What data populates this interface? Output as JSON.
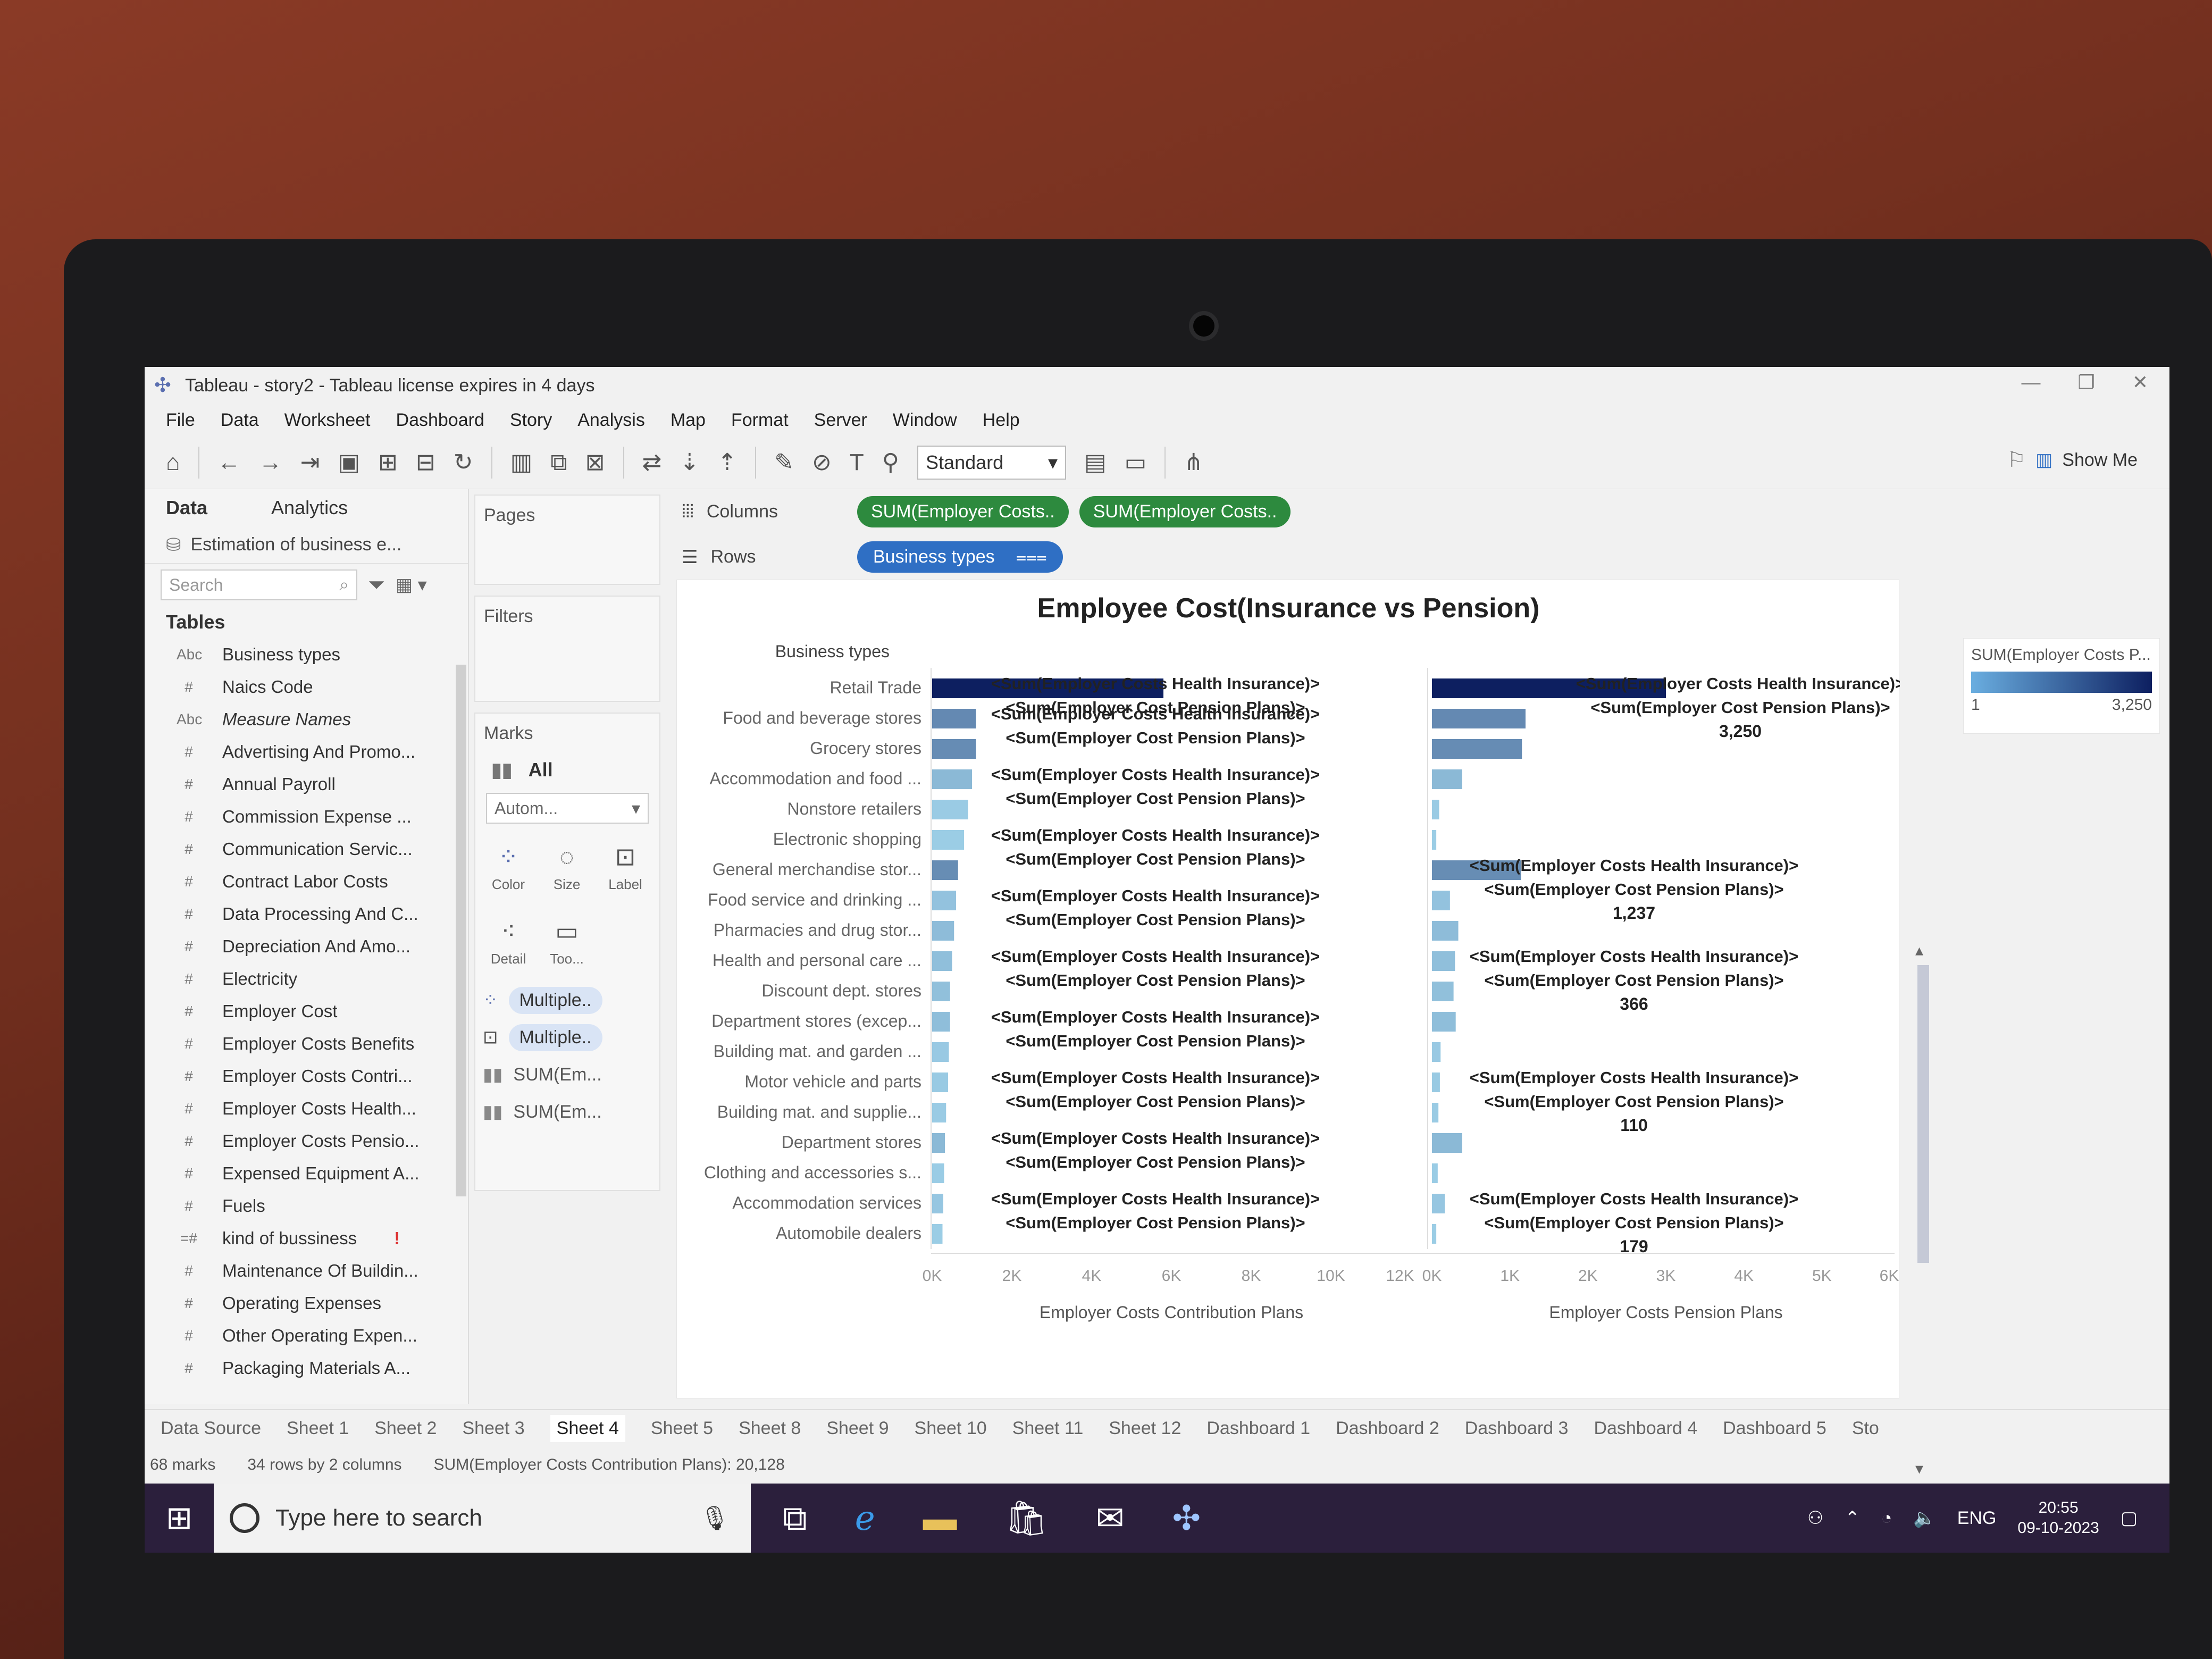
{
  "window": {
    "title": "Tableau - story2 - Tableau license expires in 4 days"
  },
  "menu": [
    "File",
    "Data",
    "Worksheet",
    "Dashboard",
    "Story",
    "Analysis",
    "Map",
    "Format",
    "Server",
    "Window",
    "Help"
  ],
  "toolbar": {
    "fit": "Standard",
    "show_me": "Show Me"
  },
  "left": {
    "tab_data": "Data",
    "tab_analytics": "Analytics",
    "datasource": "Estimation of business e...",
    "search_placeholder": "Search",
    "tables_header": "Tables",
    "fields": [
      {
        "type": "Abc",
        "name": "Business types"
      },
      {
        "type": "#",
        "name": "Naics Code"
      },
      {
        "type": "Abc",
        "name": "Measure Names",
        "italic": true
      },
      {
        "type": "#",
        "name": "Advertising And Promo..."
      },
      {
        "type": "#",
        "name": "Annual Payroll"
      },
      {
        "type": "#",
        "name": "Commission Expense ..."
      },
      {
        "type": "#",
        "name": "Communication Servic..."
      },
      {
        "type": "#",
        "name": "Contract Labor Costs"
      },
      {
        "type": "#",
        "name": "Data Processing And C..."
      },
      {
        "type": "#",
        "name": "Depreciation And Amo..."
      },
      {
        "type": "#",
        "name": "Electricity"
      },
      {
        "type": "#",
        "name": "Employer Cost"
      },
      {
        "type": "#",
        "name": "Employer Costs Benefits"
      },
      {
        "type": "#",
        "name": "Employer Costs Contri..."
      },
      {
        "type": "#",
        "name": "Employer Costs Health..."
      },
      {
        "type": "#",
        "name": "Employer Costs Pensio..."
      },
      {
        "type": "#",
        "name": "Expensed Equipment A..."
      },
      {
        "type": "#",
        "name": "Fuels"
      },
      {
        "type": "=#",
        "name": "kind of bussiness",
        "warn": "!"
      },
      {
        "type": "#",
        "name": "Maintenance Of Buildin..."
      },
      {
        "type": "#",
        "name": "Operating Expenses"
      },
      {
        "type": "#",
        "name": "Other Operating Expen..."
      },
      {
        "type": "#",
        "name": "Packaging Materials A..."
      }
    ]
  },
  "cards": {
    "pages": "Pages",
    "filters": "Filters",
    "marks": "Marks",
    "all": "All",
    "mark_type": "Autom...",
    "color": "Color",
    "size": "Size",
    "label": "Label",
    "detail": "Detail",
    "tooltip": "Too...",
    "pill1": "Multiple..",
    "pill2": "Multiple..",
    "pill3": "SUM(Em...",
    "pill4": "SUM(Em..."
  },
  "shelves": {
    "columns_label": "Columns",
    "rows_label": "Rows",
    "col_pill1": "SUM(Employer Costs..",
    "col_pill2": "SUM(Employer Costs..",
    "row_pill": "Business types"
  },
  "legend": {
    "title": "SUM(Employer Costs P...",
    "min": "1",
    "max": "3,250",
    "color_min": "#6aaee0",
    "color_max": "#0d1f60"
  },
  "chart_data": {
    "type": "bar",
    "title": "Employee Cost(Insurance vs Pension)",
    "row_header": "Business types",
    "categories": [
      "Retail Trade",
      "Food and beverage stores",
      "Grocery stores",
      "Accommodation and food ...",
      "Nonstore retailers",
      "Electronic shopping",
      "General merchandise stor...",
      "Food service and drinking ...",
      "Pharmacies and drug stor...",
      "Health and personal care ...",
      "Discount dept. stores",
      "Department stores (excep...",
      "Building mat. and garden ...",
      "Motor vehicle and parts",
      "Building mat. and supplie...",
      "Department stores",
      "Clothing and accessories s...",
      "Accommodation services",
      "Automobile dealers"
    ],
    "panes": [
      {
        "xlabel": "Employer Costs Contribution Plans",
        "xlim": [
          0,
          12000
        ],
        "ticks": [
          "0K",
          "2K",
          "4K",
          "6K",
          "8K",
          "10K",
          "12K"
        ],
        "values": [
          5800,
          1100,
          1100,
          1000,
          900,
          800,
          650,
          600,
          550,
          500,
          450,
          450,
          420,
          400,
          350,
          320,
          300,
          280,
          260
        ]
      },
      {
        "xlabel": "Employer Costs Pension Plans",
        "xlim": [
          0,
          6500
        ],
        "ticks": [
          "0K",
          "1K",
          "2K",
          "3K",
          "4K",
          "5K",
          "6K"
        ],
        "values": [
          3250,
          1300,
          1250,
          420,
          100,
          60,
          1237,
          250,
          366,
          320,
          300,
          330,
          120,
          110,
          90,
          420,
          80,
          179,
          60
        ]
      }
    ],
    "label_line1": "<Sum(Employer Costs Health Insurance)>",
    "label_line2": "<Sum(Employer Cost Pension Plans)>",
    "pane1_label_rows": [
      0,
      1,
      3,
      5,
      7,
      9,
      11,
      13,
      15,
      17,
      19
    ],
    "pane2_labels": [
      {
        "row": 0,
        "value": "3,250"
      },
      {
        "row": 6,
        "value": "1,237"
      },
      {
        "row": 9,
        "value": "366"
      },
      {
        "row": 13,
        "value": "110"
      },
      {
        "row": 17,
        "value": "179"
      }
    ]
  },
  "sheets": [
    "Data Source",
    "Sheet 1",
    "Sheet 2",
    "Sheet 3",
    "Sheet 4",
    "Sheet 5",
    "Sheet 8",
    "Sheet 9",
    "Sheet 10",
    "Sheet 11",
    "Sheet 12",
    "Dashboard 1",
    "Dashboard 2",
    "Dashboard 3",
    "Dashboard 4",
    "Dashboard 5",
    "Sto"
  ],
  "active_sheet": "Sheet 4",
  "status": {
    "marks": "68 marks",
    "dims": "34 rows by 2 columns",
    "sum": "SUM(Employer Costs Contribution Plans): 20,128"
  },
  "taskbar": {
    "search": "Type here to search",
    "lang": "ENG",
    "time": "20:55",
    "date": "09-10-2023"
  }
}
